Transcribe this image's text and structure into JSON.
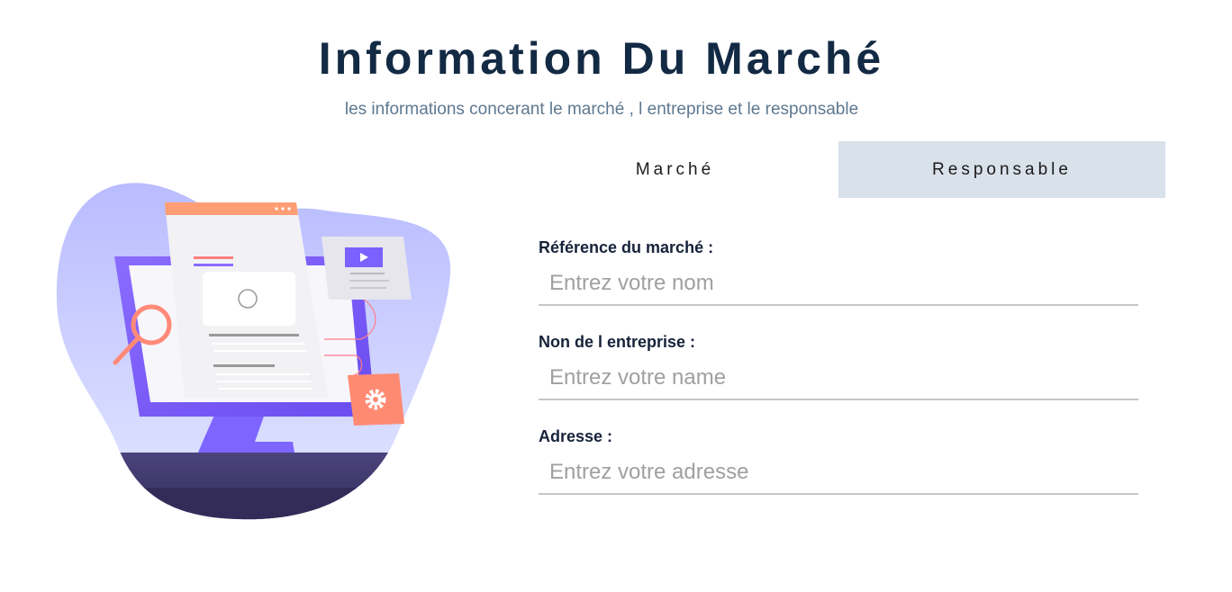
{
  "header": {
    "title": "Information Du Marché",
    "subtitle": "les informations concerant le marché , l entreprise et le responsable"
  },
  "tabs": [
    {
      "label": "Marché",
      "active": true
    },
    {
      "label": "Responsable",
      "active": false
    }
  ],
  "form": {
    "fields": [
      {
        "label": "Référence du marché :",
        "placeholder": "Entrez votre nom",
        "value": ""
      },
      {
        "label": "Non de l entreprise :",
        "placeholder": "Entrez votre name",
        "value": ""
      },
      {
        "label": "Adresse :",
        "placeholder": "Entrez votre adresse",
        "value": ""
      }
    ]
  },
  "illustration": {
    "icons": [
      "monitor-icon",
      "magnifier-icon",
      "play-icon",
      "gear-icon"
    ]
  },
  "colors": {
    "title": "#132a44",
    "subtitle": "#5e7890",
    "tab_inactive_bg": "#d9e1ea",
    "accent_purple": "#7b61ff",
    "accent_orange": "#ff8a6b",
    "blob": "#c5cbff",
    "desk": "#3d3566"
  }
}
